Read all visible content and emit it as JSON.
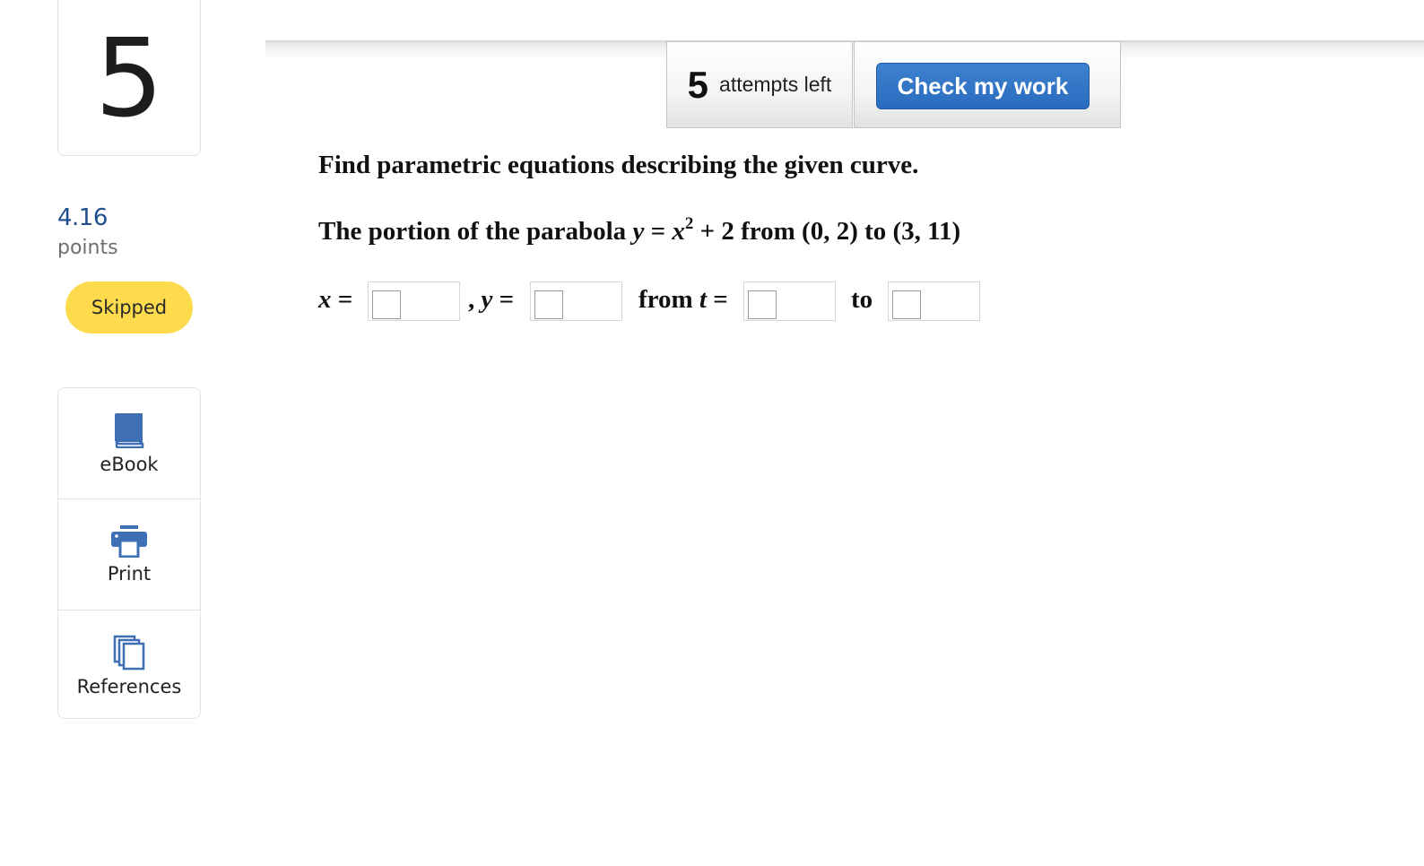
{
  "sidebar": {
    "question_number": "5",
    "points_value": "4.16",
    "points_label": "points",
    "status_badge": "Skipped",
    "tools": [
      {
        "label": "eBook",
        "icon": "book-icon"
      },
      {
        "label": "Print",
        "icon": "printer-icon"
      },
      {
        "label": "References",
        "icon": "copy-documents-icon"
      }
    ]
  },
  "toolbar": {
    "attempts_count": "5",
    "attempts_text": "attempts left",
    "check_button_label": "Check my work"
  },
  "question": {
    "instruction": "Find parametric equations describing the given curve.",
    "prompt_prefix": "The portion of the parabola ",
    "prompt_y": "y",
    "prompt_eq": " = ",
    "prompt_x": "x",
    "prompt_exp": "2",
    "prompt_suffix": " + 2 from (0, 2) to (3, 11)",
    "answer": {
      "x_var": "x",
      "y_var": "y",
      "t_var": "t",
      "equals": " =",
      "comma": ",",
      "from_word": "from ",
      "to_word": "to",
      "x_value": "",
      "y_value": "",
      "t_start_value": "",
      "t_end_value": ""
    }
  },
  "colors": {
    "accent_blue": "#2a6bbd",
    "points_blue": "#1f4e8c",
    "skipped_yellow": "#fddb4c",
    "icon_blue": "#3f6fb5"
  }
}
